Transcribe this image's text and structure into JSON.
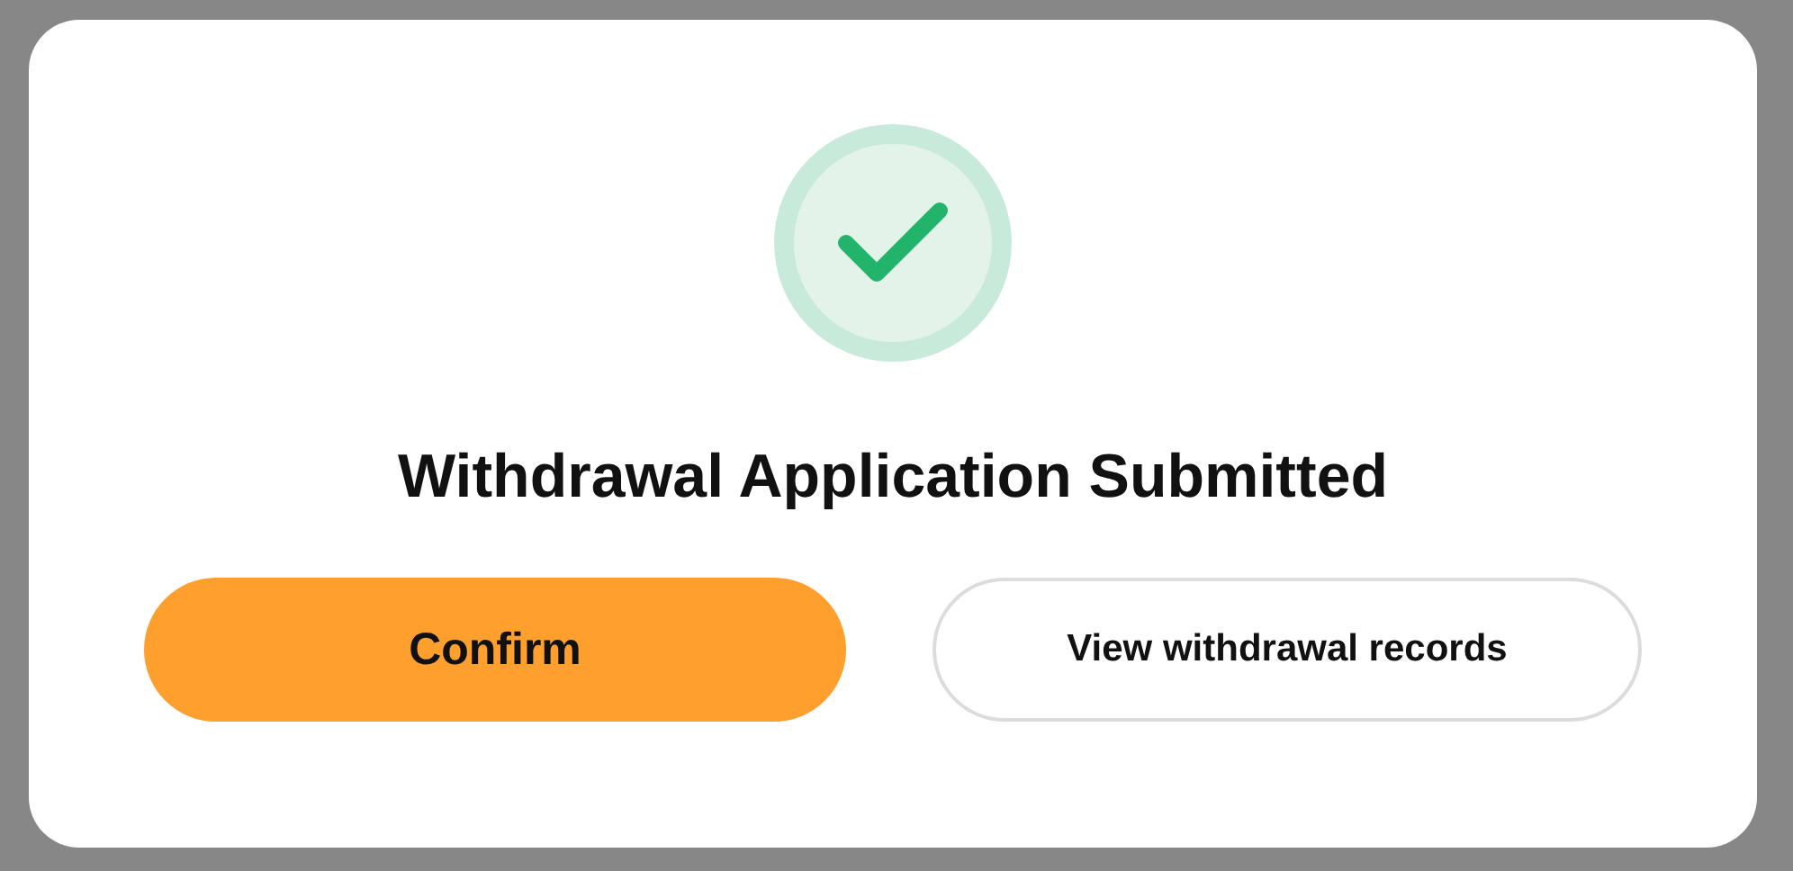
{
  "dialog": {
    "success": true,
    "title": "Withdrawal Application Submitted",
    "buttons": [
      {
        "label": "Confirm",
        "kind": "primary"
      },
      {
        "label": "View withdrawal records",
        "kind": "secondary"
      }
    ]
  }
}
